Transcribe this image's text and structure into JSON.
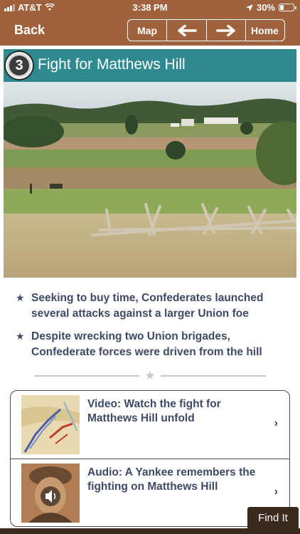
{
  "status_bar": {
    "carrier": "AT&T",
    "time": "3:38 PM",
    "battery": "30%",
    "battery_level": 0.3
  },
  "nav": {
    "back_label": "Back",
    "map_label": "Map",
    "home_label": "Home",
    "prev_icon": "arrow-left-icon",
    "next_icon": "arrow-right-icon"
  },
  "title": {
    "stop_number": "3",
    "text": "Fight for Matthews Hill"
  },
  "bullets": [
    "Seeking to buy time, Confederates launched several attacks against a larger Union foe",
    "Despite wrecking two Union brigades, Confederate forces were driven from the hill"
  ],
  "media": [
    {
      "label": "Video: Watch the fight for Matthews Hill unfold",
      "thumb": "battle-map-thumbnail"
    },
    {
      "label": "Audio: A Yankee remembers the fighting on Matthews Hill",
      "thumb": "soldier-portrait-thumbnail"
    }
  ],
  "find_it": "Find It",
  "colors": {
    "brand_brown": "#a0623c",
    "title_teal": "#2f8a8f",
    "text_navy": "#3e4a66",
    "dark_brown": "#3c2a1e"
  }
}
